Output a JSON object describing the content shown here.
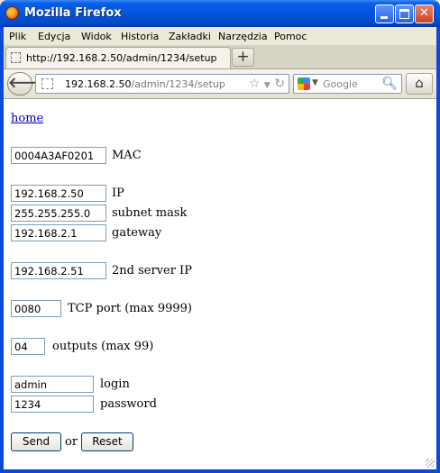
{
  "window": {
    "title": "Mozilla Firefox"
  },
  "menu": [
    "Plik",
    "Edycja",
    "Widok",
    "Historia",
    "Zakładki",
    "Narzędzia",
    "Pomoc"
  ],
  "tab": {
    "title": "http://192.168.2.50/admin/1234/setup",
    "new_tab": "+"
  },
  "nav": {
    "url_host": "192.168.2.50",
    "url_path": "/admin/1234/setup",
    "search_placeholder": "Google"
  },
  "page": {
    "home_link": "home",
    "mac": {
      "value": "0004A3AF0201",
      "label": "MAC"
    },
    "ip": {
      "value": "192.168.2.50",
      "label": "IP"
    },
    "subnet": {
      "value": "255.255.255.0",
      "label": "subnet mask"
    },
    "gateway": {
      "value": "192.168.2.1",
      "label": "gateway"
    },
    "server2": {
      "value": "192.168.2.51",
      "label": "2nd server IP"
    },
    "tcp_port": {
      "value": "0080",
      "label": "TCP port (max 9999)"
    },
    "outputs": {
      "value": "04",
      "label": "outputs (max 99)"
    },
    "login": {
      "value": "admin",
      "label": "login"
    },
    "password": {
      "value": "1234",
      "label": "password"
    },
    "send_label": "Send",
    "or_text": "or",
    "reset_label": "Reset"
  }
}
